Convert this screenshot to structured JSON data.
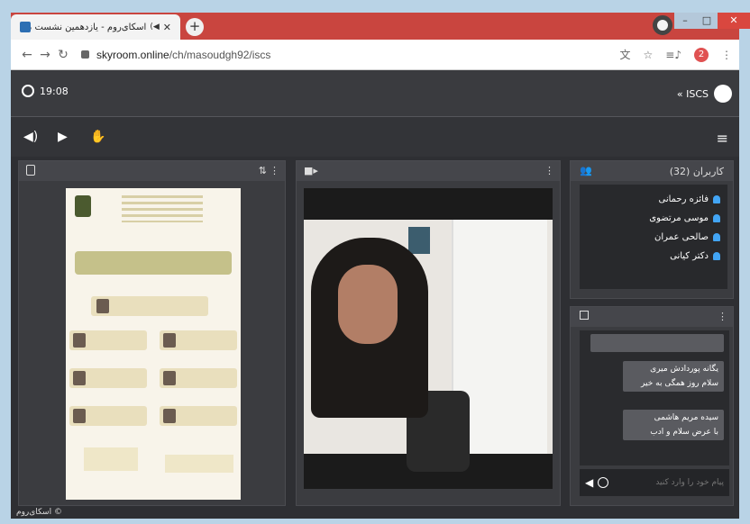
{
  "browser": {
    "tab_title": "اسکای‌روم - یازدهمین نشست مشاو...",
    "url_host": "skyroom.online",
    "url_path": "/ch/masoudgh92/iscs",
    "profile_badge": "2"
  },
  "app": {
    "clock": "19:08",
    "room_name": "« ISCS"
  },
  "users": {
    "header": "کاربران (32)",
    "items": [
      {
        "name": "فائزه رحمانی"
      },
      {
        "name": "موسی مرتضوی"
      },
      {
        "name": "صالحی عمران"
      },
      {
        "name": "دکتر کیانی"
      }
    ]
  },
  "chat": {
    "messages": [
      {
        "author": "یگانه پوردادش میری",
        "text": "سلام روز همگی به خیر"
      },
      {
        "author": "سیده مریم هاشمی",
        "text": "با عرض سلام و ادب"
      }
    ],
    "input_placeholder": "پیام خود را وارد کنید"
  },
  "footer": {
    "brand": "اسکای‌روم ©"
  },
  "icons": {
    "speaker": "speaker-icon",
    "play": "play-icon",
    "hand": "raise-hand-icon",
    "menu": "menu-icon",
    "video": "video-icon",
    "chat": "chat-icon",
    "users": "users-icon"
  },
  "colors": {
    "accent": "#42a5f5",
    "panel": "#3b3c40",
    "background": "#2e2f33"
  }
}
